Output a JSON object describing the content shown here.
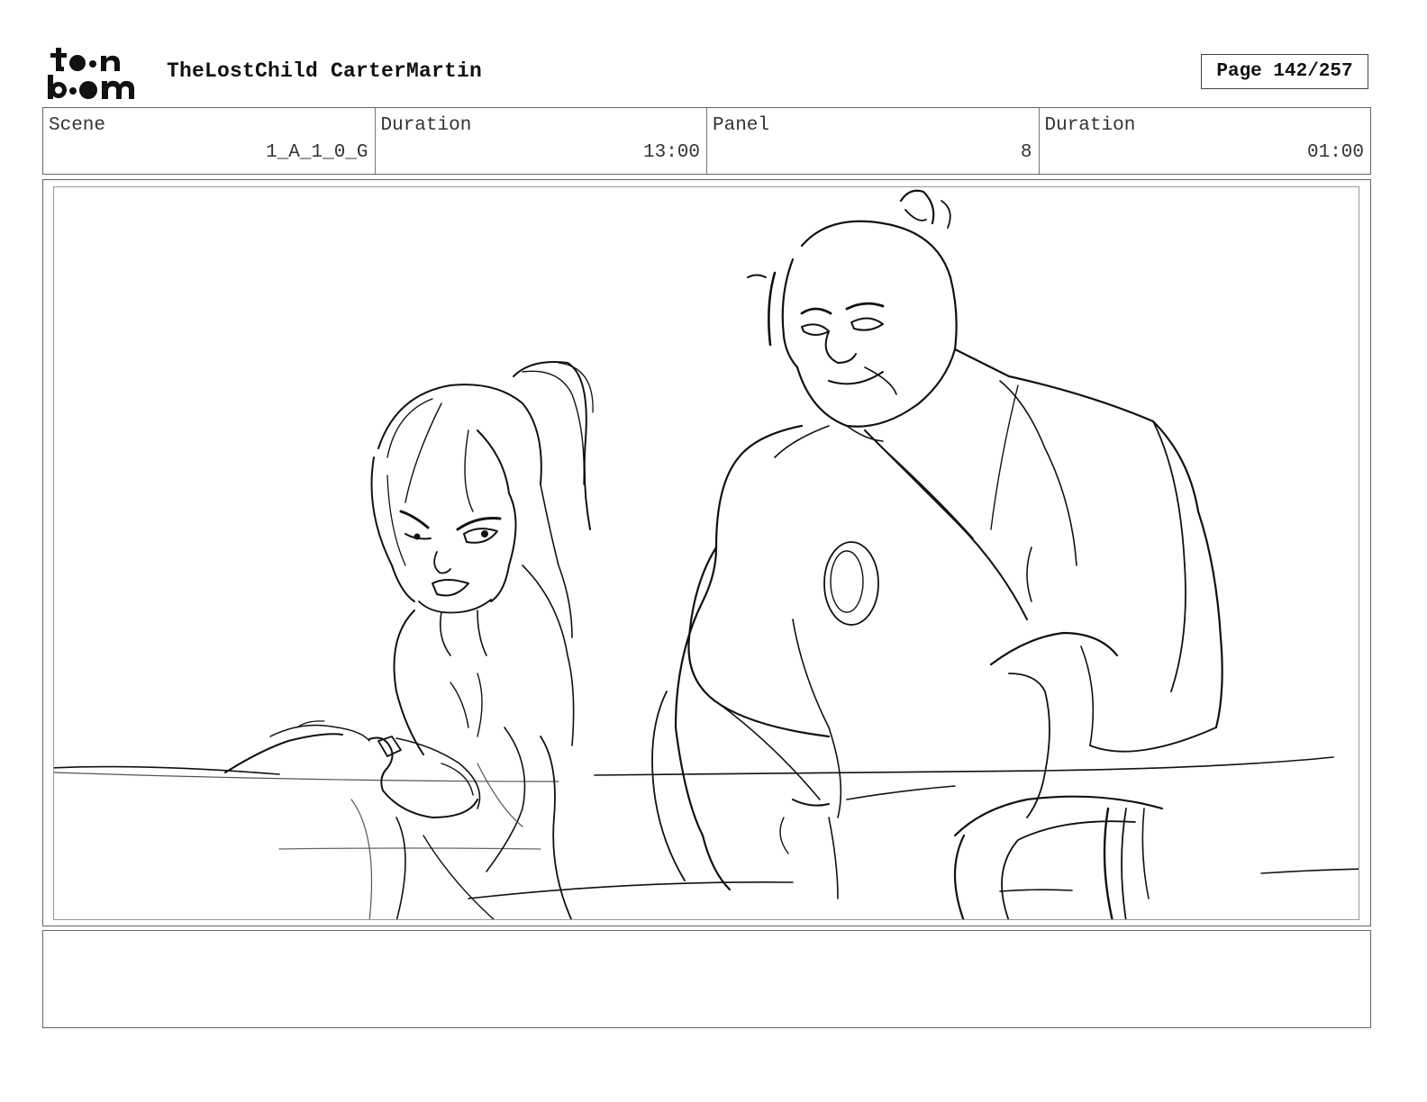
{
  "header": {
    "logo_text": "toon boom",
    "project_title": "TheLostChild CarterMartin",
    "page_label": "Page 142/257"
  },
  "info": {
    "scene": {
      "label": "Scene",
      "value": "1_A_1_0_G"
    },
    "scene_duration": {
      "label": "Duration",
      "value": "13:00"
    },
    "panel": {
      "label": "Panel",
      "value": "8"
    },
    "panel_duration": {
      "label": "Duration",
      "value": "01:00"
    }
  },
  "notes": {
    "text": ""
  }
}
